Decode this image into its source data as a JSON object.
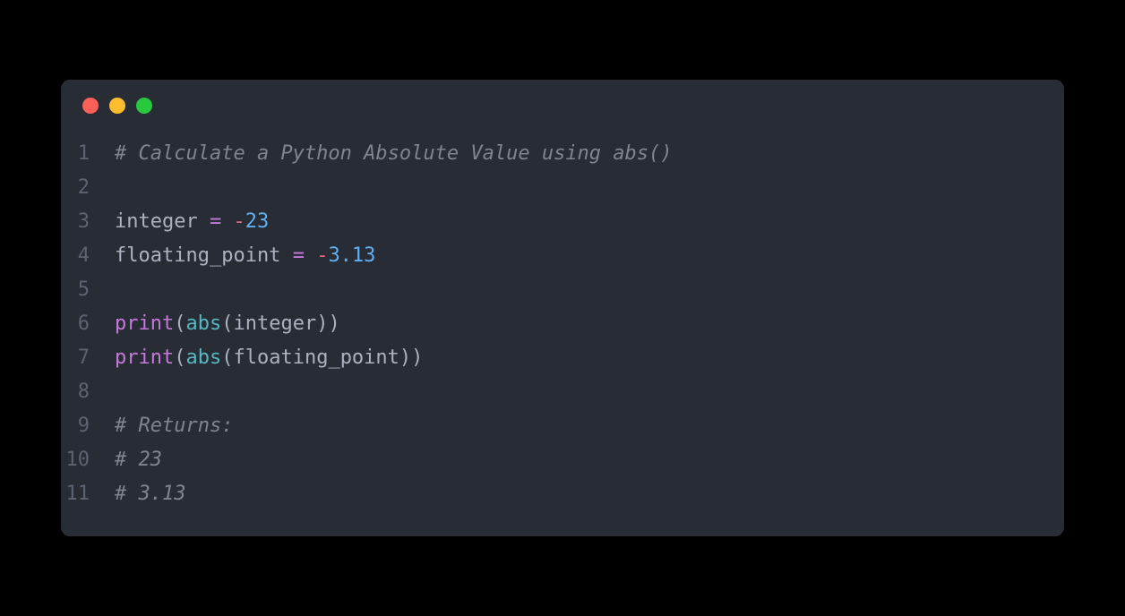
{
  "lines": [
    {
      "num": "1",
      "tokens": [
        {
          "cls": "tok-comment",
          "text": "# Calculate a Python Absolute Value using abs()"
        }
      ]
    },
    {
      "num": "2",
      "tokens": []
    },
    {
      "num": "3",
      "tokens": [
        {
          "cls": "tok-plain",
          "text": "integer "
        },
        {
          "cls": "tok-operator",
          "text": "="
        },
        {
          "cls": "tok-plain",
          "text": " "
        },
        {
          "cls": "tok-negative",
          "text": "-"
        },
        {
          "cls": "tok-number",
          "text": "23"
        }
      ]
    },
    {
      "num": "4",
      "tokens": [
        {
          "cls": "tok-plain",
          "text": "floating_point "
        },
        {
          "cls": "tok-operator",
          "text": "="
        },
        {
          "cls": "tok-plain",
          "text": " "
        },
        {
          "cls": "tok-negative",
          "text": "-"
        },
        {
          "cls": "tok-number",
          "text": "3.13"
        }
      ]
    },
    {
      "num": "5",
      "tokens": []
    },
    {
      "num": "6",
      "tokens": [
        {
          "cls": "tok-builtin",
          "text": "print"
        },
        {
          "cls": "tok-paren",
          "text": "("
        },
        {
          "cls": "tok-method",
          "text": "abs"
        },
        {
          "cls": "tok-paren",
          "text": "("
        },
        {
          "cls": "tok-plain",
          "text": "integer"
        },
        {
          "cls": "tok-paren",
          "text": "))"
        }
      ]
    },
    {
      "num": "7",
      "tokens": [
        {
          "cls": "tok-builtin",
          "text": "print"
        },
        {
          "cls": "tok-paren",
          "text": "("
        },
        {
          "cls": "tok-method",
          "text": "abs"
        },
        {
          "cls": "tok-paren",
          "text": "("
        },
        {
          "cls": "tok-plain",
          "text": "floating_point"
        },
        {
          "cls": "tok-paren",
          "text": "))"
        }
      ]
    },
    {
      "num": "8",
      "tokens": []
    },
    {
      "num": "9",
      "tokens": [
        {
          "cls": "tok-comment",
          "text": "# Returns:"
        }
      ]
    },
    {
      "num": "10",
      "tokens": [
        {
          "cls": "tok-comment",
          "text": "# 23"
        }
      ]
    },
    {
      "num": "11",
      "tokens": [
        {
          "cls": "tok-comment",
          "text": "# 3.13"
        }
      ]
    }
  ]
}
